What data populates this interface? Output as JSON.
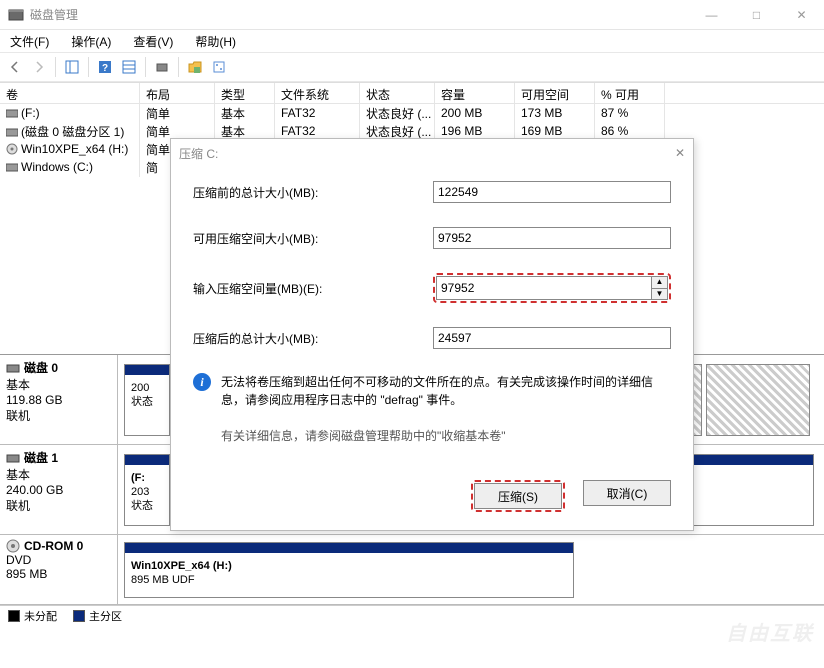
{
  "window": {
    "title": "磁盘管理",
    "min_label": "—",
    "max_label": "□",
    "close_label": "✕"
  },
  "menu": {
    "file": "文件(F)",
    "action": "操作(A)",
    "view": "查看(V)",
    "help": "帮助(H)"
  },
  "columns": {
    "vol": "卷",
    "layout": "布局",
    "type": "类型",
    "fs": "文件系统",
    "status": "状态",
    "capacity": "容量",
    "free": "可用空间",
    "pct": "% 可用"
  },
  "rows": [
    {
      "name": "(F:)",
      "layout": "简单",
      "type": "基本",
      "fs": "FAT32",
      "status": "状态良好 (...",
      "capacity": "200 MB",
      "free": "173 MB",
      "pct": "87 %"
    },
    {
      "name": "(磁盘 0 磁盘分区 1)",
      "layout": "简单",
      "type": "基本",
      "fs": "FAT32",
      "status": "状态良好 (...",
      "capacity": "196 MB",
      "free": "169 MB",
      "pct": "86 %"
    },
    {
      "name": "Win10XPE_x64 (H:)",
      "layout": "简单",
      "type": "",
      "fs": "",
      "status": "",
      "capacity": "",
      "free": "",
      "pct": ""
    },
    {
      "name": "Windows (C:)",
      "layout": "简",
      "type": "",
      "fs": "",
      "status": "",
      "capacity": "",
      "free": "",
      "pct": ""
    }
  ],
  "disks": [
    {
      "name": "磁盘 0",
      "type": "基本",
      "size": "119.88 GB",
      "status": "联机",
      "part1_size": "200",
      "part1_status": "状态"
    },
    {
      "name": "磁盘 1",
      "type": "基本",
      "size": "240.00 GB",
      "status": "联机",
      "part1_name": "(F:",
      "part1_size": "203",
      "part1_status": "状态"
    },
    {
      "name": "CD-ROM 0",
      "type": "DVD",
      "size": "895 MB",
      "part_name": "Win10XPE_x64  (H:)",
      "part_size": "895 MB UDF"
    }
  ],
  "legend": {
    "unalloc": "未分配",
    "primary": "主分区"
  },
  "dialog": {
    "title": "压缩 C:",
    "close": "✕",
    "before_label": "压缩前的总计大小(MB):",
    "before_value": "122549",
    "avail_label": "可用压缩空间大小(MB):",
    "avail_value": "97952",
    "input_label": "输入压缩空间量(MB)(E):",
    "input_value": "97952",
    "after_label": "压缩后的总计大小(MB):",
    "after_value": "24597",
    "info_text": "无法将卷压缩到超出任何不可移动的文件所在的点。有关完成该操作时间的详细信息，请参阅应用程序日志中的 \"defrag\" 事件。",
    "help_text": "有关详细信息，请参阅磁盘管理帮助中的\"收缩基本卷\"",
    "shrink_btn": "压缩(S)",
    "cancel_btn": "取消(C)"
  },
  "watermark": "自由互联"
}
